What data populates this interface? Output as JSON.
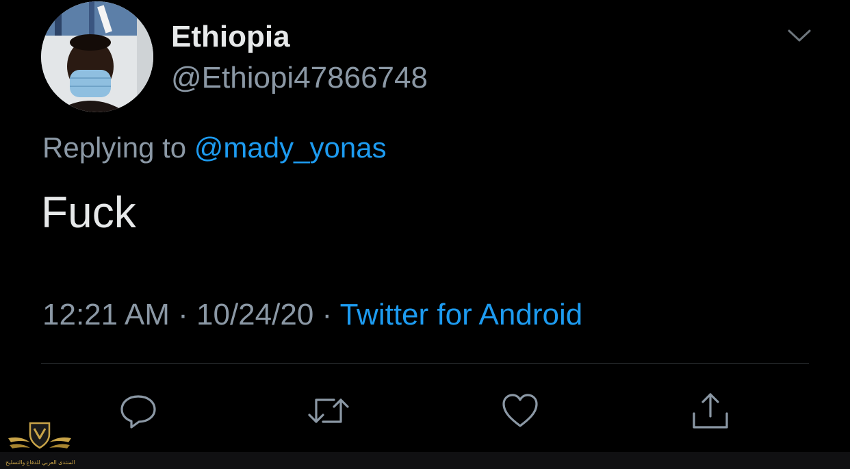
{
  "tweet": {
    "author": {
      "display_name": "Ethiopia",
      "handle": "@Ethiopi47866748"
    },
    "replying_to_prefix": "Replying to ",
    "replying_to_handle": "@mady_yonas",
    "text": "Fuck",
    "time": "12:21 AM",
    "separator": " · ",
    "date": "10/24/20",
    "source": "Twitter for Android"
  },
  "actions": [
    {
      "name": "reply",
      "icon": "reply-icon"
    },
    {
      "name": "retweet",
      "icon": "retweet-icon"
    },
    {
      "name": "like",
      "icon": "heart-icon"
    },
    {
      "name": "share",
      "icon": "share-icon"
    }
  ],
  "watermark": {
    "text": "المنتدى العربي للدفاع والتسليح"
  },
  "colors": {
    "background": "#000000",
    "primary_text": "#e7e9ea",
    "secondary_text": "#8b98a5",
    "link": "#1d9bf0",
    "divider": "#2f3336",
    "watermark_gold": "#c9a448"
  }
}
